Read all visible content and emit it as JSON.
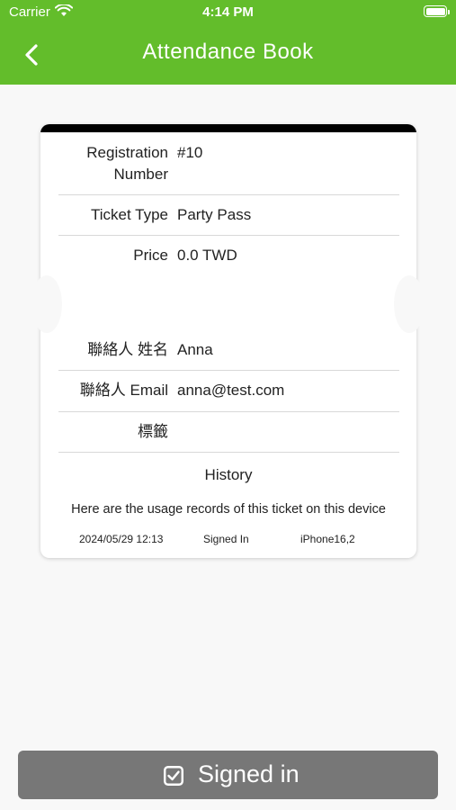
{
  "status": {
    "carrier": "Carrier",
    "time": "4:14 PM"
  },
  "nav": {
    "title": "Attendance Book"
  },
  "ticket": {
    "fields": [
      {
        "label": "Registration Number",
        "value": "#10"
      },
      {
        "label": "Ticket Type",
        "value": "Party Pass"
      },
      {
        "label": "Price",
        "value": "0.0 TWD"
      },
      {
        "label": "聯絡人 姓名",
        "value": "Anna"
      },
      {
        "label": "聯絡人 Email",
        "value": "anna@test.com"
      },
      {
        "label": "標籤",
        "value": ""
      }
    ],
    "history": {
      "title": "History",
      "description": "Here are the usage records of this ticket on this device",
      "records": [
        {
          "datetime": "2024/05/29 12:13",
          "action": "Signed In",
          "device": "iPhone16,2"
        }
      ]
    }
  },
  "signed_button": {
    "label": "Signed in"
  },
  "colors": {
    "accent": "#63bd2b",
    "button": "#777777",
    "background": "#f8f8f8"
  }
}
